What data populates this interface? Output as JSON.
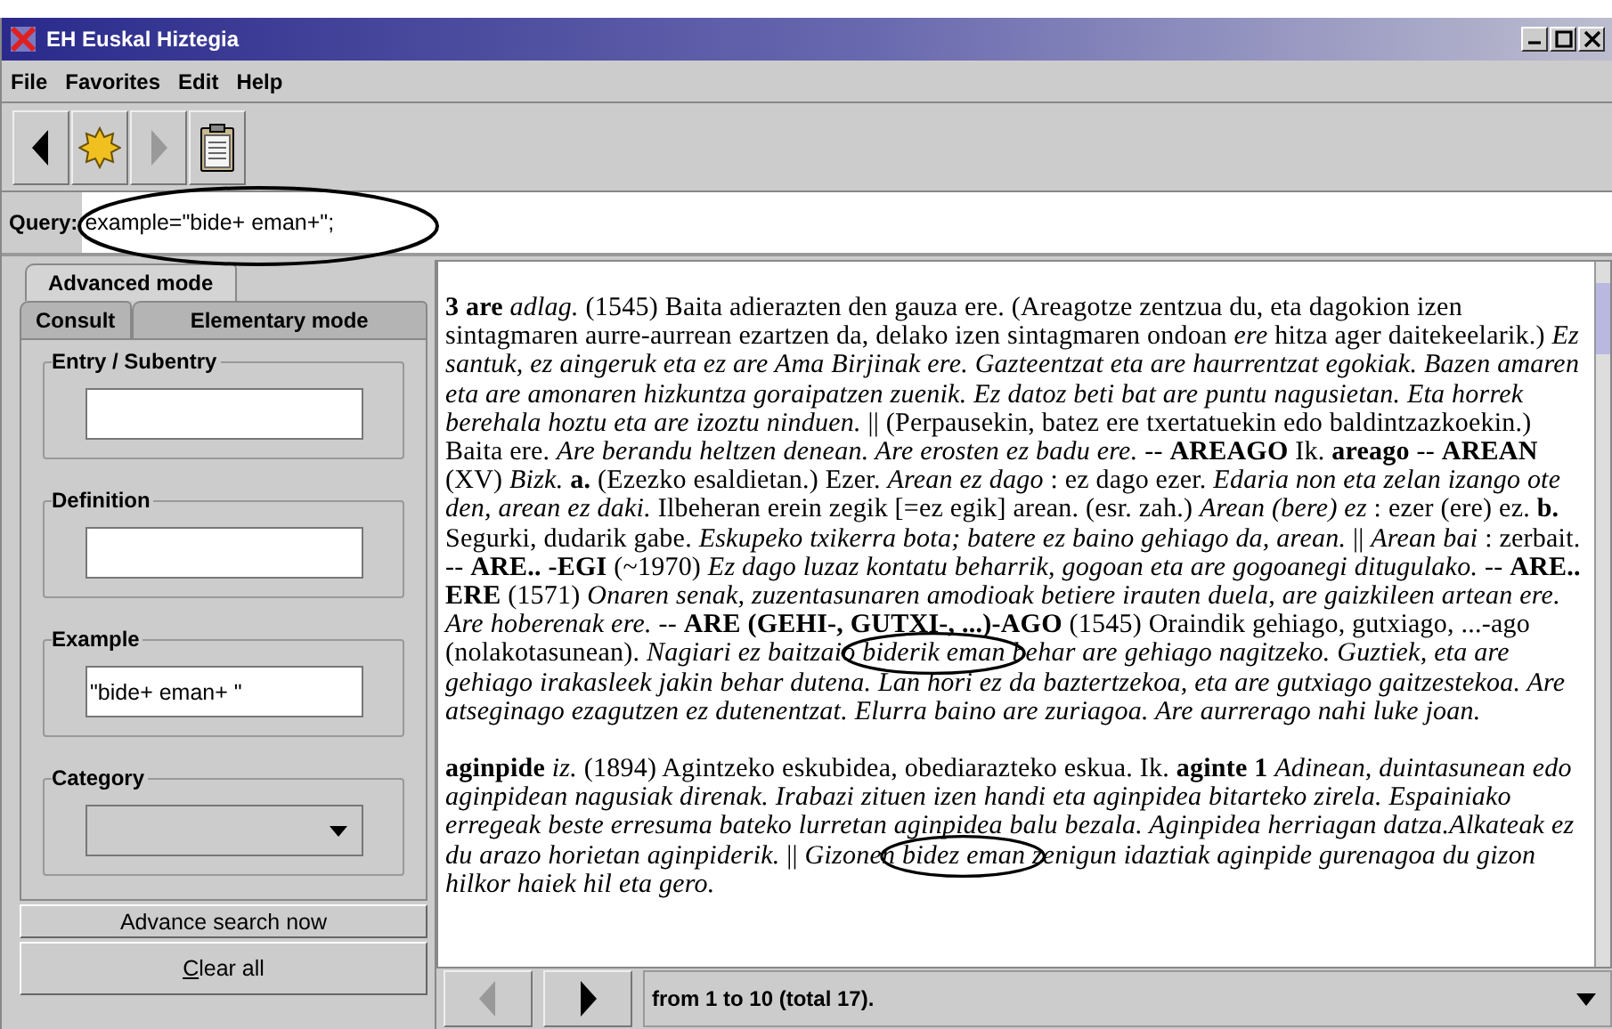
{
  "window": {
    "title": "EH Euskal Hiztegia"
  },
  "menu": [
    "File",
    "Favorites",
    "Edit",
    "Help"
  ],
  "toolbar": [
    {
      "kind": "back",
      "disabled": false
    },
    {
      "kind": "new",
      "disabled": false
    },
    {
      "kind": "forward",
      "disabled": true
    },
    {
      "kind": "clipboard",
      "disabled": false
    }
  ],
  "query": {
    "label": "Query:",
    "value": "example=\"bide+ eman+\";"
  },
  "tab_rows": [
    [
      {
        "label": "Advanced mode",
        "selected": true
      }
    ],
    [
      {
        "label": "Consult",
        "selected": false
      },
      {
        "label": "Elementary mode",
        "selected": false
      }
    ]
  ],
  "fields": [
    {
      "kind": "text",
      "label": "Entry / Subentry"
    },
    {
      "kind": "text",
      "label": "Definition"
    },
    {
      "kind": "text",
      "label": "Example",
      "value": "\"bide+ eman+ \""
    },
    {
      "kind": "select",
      "label": "Category"
    }
  ],
  "buttons": [
    {
      "label": "Advance search now"
    },
    {
      "mnemonic": "C",
      "label_rest": "lear all"
    }
  ],
  "results": {
    "entries": [
      {
        "segments": [
          {
            "text": "**3 are** *adlag.* (1545) Baita adierazten den gauza ere. (Areagotze zentzua du, eta dagokion izen sintagmaren aurre-aurrean ezartzen da, delako izen sintagmaren ondoan *ere* hitza ager daitekeelarik.) *Ez santuk, ez aingeruk eta ez are Ama Birjinak ere. Gazteentzat eta are haurrentzat egokiak. Bazen amaren eta are amonaren hizkuntza goraipatzen zuenik. Ez datoz beti bat are puntu nagusietan. Eta horrek berehala hoztu eta are izoztu ninduen.* || (Perpausekin, batez ere txertatuekin edo baldintzazkoekin.) Baita ere. *Are berandu heltzen denean. Are erosten ez badu ere.* -- **AREAGO** Ik. **areago** -- **AREAN** (XV) *Bizk.* **a.** (Ezezko esaldietan.) Ezer. *Arean ez dago* : ez dago ezer. *Edaria non eta zelan izango ote den, arean ez daki.* Ilbeheran erein zegik [=ez egik] arean. (esr. zah.) *Arean (bere) ez* : ezer (ere) ez. **b.** Segurki, dudarik gabe. *Eskupeko txikerra bota; batere ez baino gehiago da, arean.* || *Arean bai* : zerbait. -- **ARE.. -EGI** (~1970) *Ez dago luzaz kontatu beharrik, gogoan eta are gogoanegi ditugulako.* -- **ARE.. ERE** (1571) *Onaren senak, zuzentasunaren amodioak betiere irauten duela, are gaizkileen artean ere. Are hoberenak ere.* -- **ARE (GEHI-, GUTXI-, ...)-AGO** (1545) Oraindik gehiago, gutxiago, ...-ago (nolakotasunean). *Nagiari ez baitzaio* ",
            "circled": false
          },
          {
            "text": "*biderik eman*",
            "circled": true
          },
          {
            "text": " *behar are gehiago nagitzeko. Guztiek, eta are gehiago irakasleek jakin behar dutena. Lan hori ez da baztertzekoa, eta are gutxiago gaitzestekoa. Are atseginago ezagutzen ez dutenentzat. Elurra baino are zuriagoa. Are aurrerago nahi luke joan.*",
            "circled": false
          }
        ]
      },
      {
        "segments": [
          {
            "text": "**aginpide** *iz.* (1894) Agintzeko eskubidea, obediarazteko eskua. Ik. **aginte 1** *Adinean, duintasunean edo aginpidean nagusiak direnak. Irabazi zituen izen handi eta aginpidea bitarteko zirela. Espainiako erregeak beste erresuma bateko lurretan aginpidea balu bezala. Aginpidea herriagan datza.Alkateak ez du arazo horietan aginpiderik.* || *Gizonen* ",
            "circled": false
          },
          {
            "text": "*bidez eman*",
            "circled": true
          },
          {
            "text": " *zenigun idaztiak aginpide gurenagoa du gizon hilkor haiek hil eta gero.*",
            "circled": false
          }
        ]
      }
    ]
  },
  "pager": {
    "prev_disabled": true,
    "next_disabled": false,
    "status": "from 1 to 10 (total 17)."
  }
}
